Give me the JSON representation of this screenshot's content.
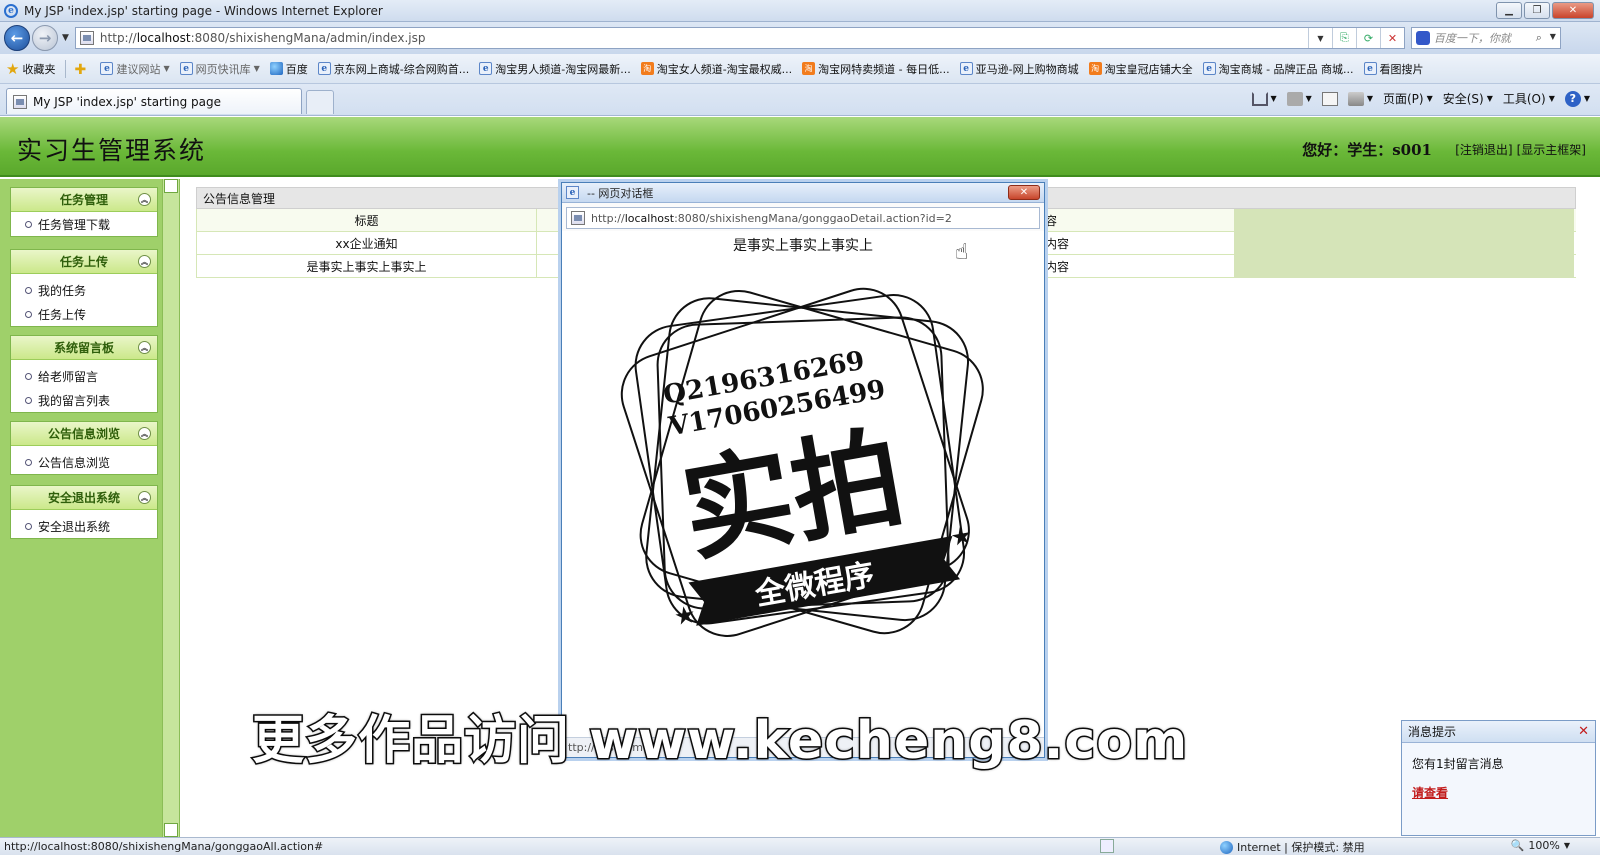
{
  "browser": {
    "window_title": "My JSP 'index.jsp' starting page - Windows Internet Explorer",
    "url_prefix": "http://",
    "url_host": "localhost",
    "url_rest": ":8080/shixishengMana/admin/index.jsp",
    "search_placeholder": "百度一下，你就",
    "favorites": [
      {
        "label": "收藏夹",
        "icon": "star-icon"
      },
      {
        "label": "建议网站",
        "icon": "ie-icon"
      },
      {
        "label": "网页快讯库",
        "icon": "ie-icon"
      },
      {
        "label": "百度",
        "icon": "globe-icon"
      },
      {
        "label": "京东网上商城-综合网购首...",
        "icon": "ie-icon"
      },
      {
        "label": "淘宝男人频道-淘宝网最新...",
        "icon": "ie-icon"
      },
      {
        "label": "淘宝女人频道-淘宝最权威...",
        "icon": "taobao-icon"
      },
      {
        "label": "淘宝网特卖频道 - 每日低...",
        "icon": "taobao-icon"
      },
      {
        "label": "亚马逊-网上购物商城",
        "icon": "ie-icon"
      },
      {
        "label": "淘宝皇冠店铺大全",
        "icon": "taobao-icon"
      },
      {
        "label": "淘宝商城 - 品牌正品 商城...",
        "icon": "ie-icon"
      },
      {
        "label": "看图搜片",
        "icon": "ie-icon"
      }
    ],
    "tab_title": "My JSP 'index.jsp' starting page",
    "commands": {
      "page": "页面(P)",
      "safety": "安全(S)",
      "tools": "工具(O)"
    },
    "status_url": "http://localhost:8080/shixishengMana/gonggaoAll.action#",
    "status_zone": "Internet | 保护模式: 禁用",
    "zoom": "100%"
  },
  "app": {
    "system_title": "实习生管理系统",
    "greeting": "您好：学生：s001",
    "logout_link": "[注销退出]",
    "show_frame_link": "[显示主框架]"
  },
  "sidebar": {
    "groups": [
      {
        "title": "任务管理",
        "items": [
          "任务管理下载"
        ]
      },
      {
        "title": "任务上传",
        "items": [
          "我的任务",
          "任务上传"
        ]
      },
      {
        "title": "系统留言板",
        "items": [
          "给老师留言",
          "我的留言列表"
        ]
      },
      {
        "title": "公告信息浏览",
        "items": [
          "公告信息浏览"
        ]
      },
      {
        "title": "安全退出系统",
        "items": [
          "安全退出系统"
        ]
      }
    ]
  },
  "main": {
    "section_title": "公告信息管理",
    "column_title": "标题",
    "column_op_fragment": "内容",
    "rows": [
      {
        "title": "xx企业通知",
        "op_fragment": "看内容"
      },
      {
        "title": "是事实上事实上事实上",
        "op_fragment": "看内容"
      }
    ]
  },
  "dialog": {
    "title": "-- 网页对话框",
    "url_prefix": "http://",
    "url_host": "localhost",
    "url_rest": ":8080/shixishengMana/gonggaoDetail.action?id=2",
    "heading": "是事实上事实上事实上",
    "status_fragment": "ttp://lo   st:8   mix"
  },
  "stamp": {
    "line1": "Q2196316269",
    "line2": "V17060256499",
    "big": "实拍",
    "banner": "全微程序"
  },
  "watermark": "更多作品访问 www.kecheng8.com",
  "notification": {
    "title": "消息提示",
    "message": "您有1封留言消息",
    "link": "请查看"
  }
}
